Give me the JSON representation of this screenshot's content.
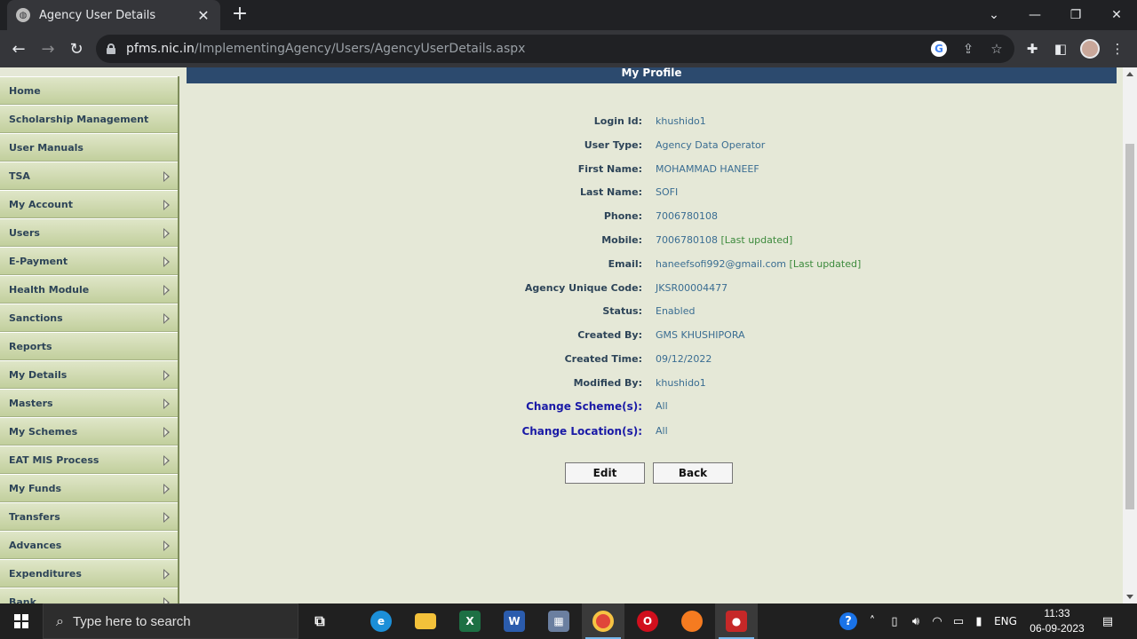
{
  "browser": {
    "tab_title": "Agency User Details",
    "url_host": "pfms.nic.in",
    "url_path": "/ImplementingAgency/Users/AgencyUserDetails.aspx"
  },
  "sidebar": {
    "items": [
      {
        "label": "Home",
        "has_submenu": false
      },
      {
        "label": "Scholarship Management",
        "has_submenu": false
      },
      {
        "label": "User Manuals",
        "has_submenu": false
      },
      {
        "label": "TSA",
        "has_submenu": true
      },
      {
        "label": "My Account",
        "has_submenu": true
      },
      {
        "label": "Users",
        "has_submenu": true
      },
      {
        "label": "E-Payment",
        "has_submenu": true
      },
      {
        "label": "Health Module",
        "has_submenu": true
      },
      {
        "label": "Sanctions",
        "has_submenu": true
      },
      {
        "label": "Reports",
        "has_submenu": false
      },
      {
        "label": "My Details",
        "has_submenu": true
      },
      {
        "label": "Masters",
        "has_submenu": true
      },
      {
        "label": "My Schemes",
        "has_submenu": true
      },
      {
        "label": "EAT MIS Process",
        "has_submenu": true
      },
      {
        "label": "My Funds",
        "has_submenu": true
      },
      {
        "label": "Transfers",
        "has_submenu": true
      },
      {
        "label": "Advances",
        "has_submenu": true
      },
      {
        "label": "Expenditures",
        "has_submenu": true
      },
      {
        "label": "Bank",
        "has_submenu": true
      }
    ]
  },
  "profile": {
    "title": "My Profile",
    "fields": [
      {
        "label": "Login Id:",
        "value": "khushido1"
      },
      {
        "label": "User Type:",
        "value": "Agency Data Operator"
      },
      {
        "label": "First Name:",
        "value": "MOHAMMAD HANEEF"
      },
      {
        "label": "Last Name:",
        "value": "SOFI"
      },
      {
        "label": "Phone:",
        "value": "7006780108"
      },
      {
        "label": "Mobile:",
        "value": "7006780108",
        "note": "[Last updated]"
      },
      {
        "label": "Email:",
        "value": "haneefsofi992@gmail.com",
        "note": "[Last updated]"
      },
      {
        "label": "Agency Unique Code:",
        "value": "JKSR00004477"
      },
      {
        "label": "Status:",
        "value": "Enabled"
      },
      {
        "label": "Created By:",
        "value": "GMS KHUSHIPORA"
      },
      {
        "label": "Created Time:",
        "value": "09/12/2022"
      },
      {
        "label": "Modified By:",
        "value": "khushido1"
      }
    ],
    "links": [
      {
        "label": "Change Scheme(s):",
        "value": "All"
      },
      {
        "label": "Change Location(s):",
        "value": "All"
      }
    ],
    "edit_label": "Edit",
    "back_label": "Back"
  },
  "taskbar": {
    "search_placeholder": "Type here to search",
    "language": "ENG",
    "time": "11:33",
    "date": "06-09-2023"
  }
}
